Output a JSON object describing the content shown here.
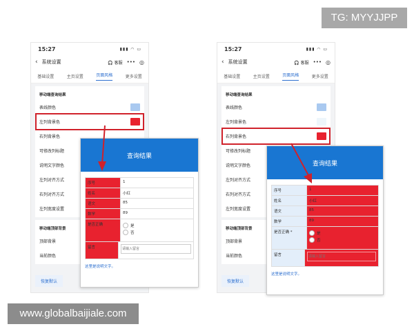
{
  "watermark": {
    "tg": "TG: MYYJJPP",
    "site": "www.globalbaijiale.com"
  },
  "phones": [
    {
      "time": "15:27",
      "status_icons": "▮▮▮ ◠ ▭",
      "nav": {
        "title": "系统设置",
        "kefu": "🎧 客服",
        "more": "•••",
        "target": "◎"
      },
      "tabs": [
        "基础设置",
        "主页设置",
        "页面风格",
        "更多设置"
      ],
      "active_tab": 2,
      "section": "移动端查询结果",
      "rows": [
        {
          "label": "表线颜色",
          "color": "#a9c9f0",
          "highlight": false
        },
        {
          "label": "左列背景色",
          "color": "#e8222f",
          "highlight": true
        },
        {
          "label": "右列背景色",
          "color": "",
          "highlight": false
        },
        {
          "label": "可修改列标题",
          "color": "",
          "highlight": false
        },
        {
          "label": "说明文字颜色",
          "color": "",
          "highlight": false
        },
        {
          "label": "左列对齐方式",
          "color": "",
          "highlight": false
        },
        {
          "label": "右列对齐方式",
          "color": "",
          "highlight": false
        },
        {
          "label": "左列宽度设置",
          "color": "",
          "highlight": false
        }
      ],
      "section2": "移动端顶部背景",
      "rows2": [
        {
          "label": "顶部背景"
        },
        {
          "label": "当前颜色"
        }
      ],
      "btn_reset": "恢复默认",
      "modal": {
        "title": "查询结果",
        "fields": [
          {
            "label": "序号",
            "value": "1"
          },
          {
            "label": "姓名",
            "value": "小红"
          },
          {
            "label": "语文",
            "value": "85"
          },
          {
            "label": "数学",
            "value": "89"
          }
        ],
        "question": "是否正确",
        "options": [
          "是",
          "否"
        ],
        "comment_label": "留言",
        "comment_placeholder": "请输入留言",
        "note": "这里是说明文字。"
      }
    },
    {
      "time": "15:27",
      "status_icons": "▮▮▮ ◠ ▭",
      "nav": {
        "title": "系统设置",
        "kefu": "🎧 客服",
        "more": "•••",
        "target": "◎"
      },
      "tabs": [
        "基础设置",
        "主页设置",
        "页面风格",
        "更多设置"
      ],
      "active_tab": 2,
      "section": "移动端查询结果",
      "rows": [
        {
          "label": "表线颜色",
          "color": "#a9c9f0",
          "highlight": false
        },
        {
          "label": "左列背景色",
          "color": "#eef6fb",
          "highlight": false
        },
        {
          "label": "右列背景色",
          "color": "#e8222f",
          "highlight": true
        },
        {
          "label": "可修改列标题",
          "color": "",
          "highlight": false
        },
        {
          "label": "说明文字颜色",
          "color": "",
          "highlight": false
        },
        {
          "label": "左列对齐方式",
          "color": "",
          "highlight": false
        },
        {
          "label": "右列对齐方式",
          "color": "",
          "highlight": false
        },
        {
          "label": "左列宽度设置",
          "color": "",
          "highlight": false
        }
      ],
      "section2": "移动端顶部背景",
      "rows2": [
        {
          "label": "顶部背景"
        },
        {
          "label": "当前颜色"
        }
      ],
      "btn_reset": "恢复默认",
      "modal": {
        "title": "查询结果",
        "fields": [
          {
            "label": "序号",
            "value": "1"
          },
          {
            "label": "姓名",
            "value": "小红"
          },
          {
            "label": "语文",
            "value": "85"
          },
          {
            "label": "数学",
            "value": "89"
          }
        ],
        "question": "是否正确 *",
        "options": [
          "是",
          "否"
        ],
        "comment_label": "留言",
        "comment_placeholder": "请输入留言",
        "note": "这里是说明文字。"
      }
    }
  ],
  "colors": {
    "accent": "#1976d2",
    "highlight": "#e8222f",
    "light_blue": "#e3eefa"
  }
}
